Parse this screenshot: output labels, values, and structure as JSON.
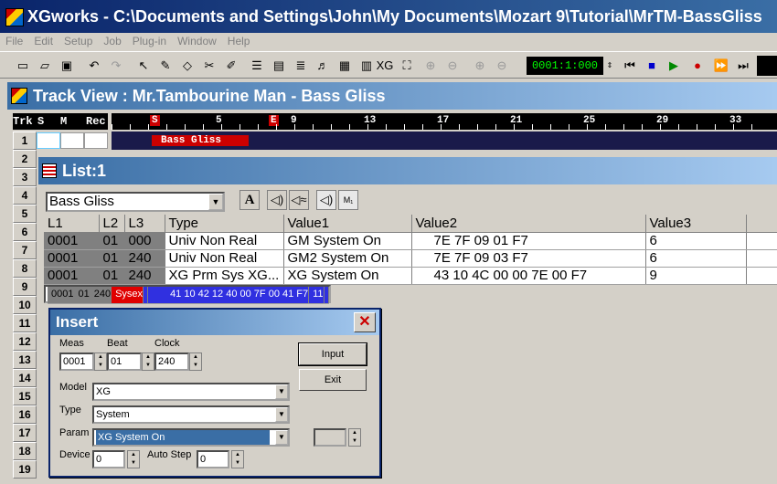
{
  "app": {
    "title": "XGworks - C:\\Documents and Settings\\John\\My Documents\\Mozart 9\\Tutorial\\MrTM-BassGliss"
  },
  "menu": [
    "File",
    "Edit",
    "Setup",
    "Job",
    "Plug-in",
    "Window",
    "Help"
  ],
  "toolbar": {
    "counter": "0001:1:000"
  },
  "trackview": {
    "title": "Track View : Mr.Tambourine Man - Bass Gliss",
    "header": {
      "trk": "Trk",
      "s": "S",
      "m": "M",
      "rec": "Rec"
    },
    "rows": [
      "1",
      "2",
      "3",
      "4",
      "5",
      "6",
      "7",
      "8",
      "9",
      "10",
      "11",
      "12",
      "13",
      "14",
      "15",
      "16",
      "17",
      "18",
      "19"
    ],
    "ruler": [
      "5",
      "9",
      "13",
      "17",
      "21",
      "25",
      "29",
      "33"
    ],
    "start_marker": "S",
    "end_marker": "E",
    "clip": "Bass Gliss"
  },
  "list": {
    "title": "List:1",
    "track_select": "Bass Gliss",
    "columns": [
      "L1",
      "L2",
      "L3",
      "Type",
      "Value1",
      "Value2",
      "Value3"
    ],
    "rows": [
      [
        "0001",
        "01",
        "000",
        "Univ Non Real",
        "GM System On",
        "7E 7F 09 01 F7",
        "6"
      ],
      [
        "0001",
        "01",
        "240",
        "Univ Non Real",
        "GM2 System On",
        "7E 7F 09 03 F7",
        "6"
      ],
      [
        "0001",
        "01",
        "240",
        "XG Prm Sys XG...",
        "XG System On",
        "43 10 4C 00 00 7E 00 F7",
        "9"
      ],
      [
        "0001",
        "01",
        "240",
        "Sysex",
        "",
        "41 10 42 12 40 00 7F 00 41 F7",
        "11"
      ]
    ]
  },
  "insert": {
    "title": "Insert",
    "meas_label": "Meas",
    "beat_label": "Beat",
    "clock_label": "Clock",
    "meas": "0001",
    "beat": "01",
    "clock": "240",
    "model_label": "Model",
    "model": "XG",
    "type_label": "Type",
    "type": "System",
    "param_label": "Param",
    "param": "XG System On",
    "device_label": "Device",
    "device": "0",
    "autostep_label": "Auto Step",
    "autostep": "0",
    "input_label": "Input",
    "exit_label": "Exit"
  }
}
